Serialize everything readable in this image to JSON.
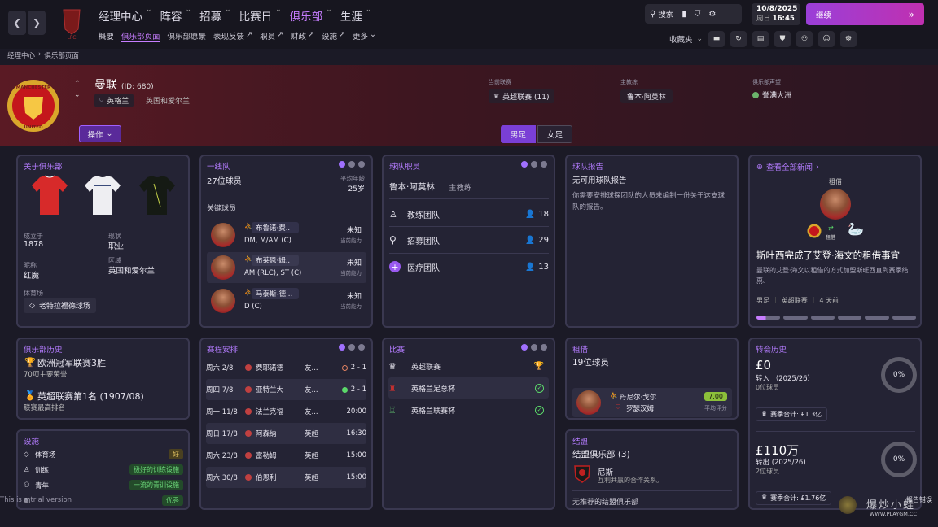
{
  "nav": {
    "main": [
      "经理中心",
      "阵容",
      "招募",
      "比赛日",
      "俱乐部",
      "生涯"
    ],
    "active_main": "俱乐部",
    "sub": [
      "概要",
      "俱乐部页面",
      "俱乐部愿景",
      "表现反馈",
      "职员",
      "财政",
      "设施",
      "更多"
    ],
    "active_sub": "俱乐部页面",
    "search_label": "搜索",
    "date": "10/8/2025",
    "weekday": "周日",
    "time": "16:45",
    "continue_label": "继续",
    "favorites_label": "收藏夹"
  },
  "breadcrumb": [
    "经理中心",
    "俱乐部页面"
  ],
  "club": {
    "name": "曼联",
    "id_text": "(ID: 680)",
    "nation_badge": "英格兰",
    "region": "英国和爱尔兰",
    "league_label": "当前联赛",
    "league": "英超联赛 (11)",
    "coach_label": "主教练",
    "coach": "鲁本·阿莫林",
    "rep_label": "俱乐部声望",
    "rep": "誉满大洲",
    "action_label": "操作",
    "men_label": "男足",
    "women_label": "女足"
  },
  "about": {
    "title": "关于俱乐部",
    "founded_label": "成立于",
    "founded": "1878",
    "status_label": "现状",
    "status": "职业",
    "nick_label": "昵称",
    "nick": "红魔",
    "area_label": "区域",
    "area": "英国和爱尔兰",
    "stadium_label": "体育场",
    "stadium": "老特拉福德球场"
  },
  "first_team": {
    "title": "一线队",
    "count": "27位球员",
    "avg_age_label": "平均年龄",
    "avg_age": "25岁",
    "key_label": "关键球员",
    "players": [
      {
        "name": "布鲁诺·费...",
        "pos": "DM, M/AM (C)",
        "ability": "未知",
        "ability_label": "当前能力"
      },
      {
        "name": "布莱恩·姆...",
        "pos": "AM (RLC), ST (C)",
        "ability": "未知",
        "ability_label": "当前能力"
      },
      {
        "name": "马泰斯-德...",
        "pos": "D (C)",
        "ability": "未知",
        "ability_label": "当前能力"
      }
    ]
  },
  "staff": {
    "title": "球队职员",
    "coach": "鲁本·阿莫林",
    "coach_role": "主教练",
    "groups": [
      {
        "label": "教练团队",
        "count": "18"
      },
      {
        "label": "招募团队",
        "count": "29"
      },
      {
        "label": "医疗团队",
        "count": "13"
      }
    ]
  },
  "report": {
    "title": "球队报告",
    "none": "无可用球队报告",
    "desc": "你需要安排球探团队的人员来编制一份关于这支球队的报告。"
  },
  "news": {
    "link": "查看全部新闻",
    "tag": "租借",
    "sub_tag": "租借",
    "headline": "斯吐西完成了艾登·海文的租借事宜",
    "body": "曼联的艾登·海文以租借的方式加盟斯旺西直到赛季结束。",
    "ellipsis": "...",
    "meta1": "男足",
    "meta2": "英超联赛",
    "meta3": "4 天前"
  },
  "history": {
    "title": "俱乐部历史",
    "h1": "欧洲冠军联赛3胜",
    "h1sub": "70项主要荣誉",
    "h2": "英超联赛第1名 (1907/08)",
    "h2sub": "联赛最高排名"
  },
  "facilities": {
    "title": "设施",
    "items": [
      {
        "label": "体育场",
        "value": "好"
      },
      {
        "label": "训练",
        "value": "极好的训练设施"
      },
      {
        "label": "青年",
        "value": "一流的青训设施"
      },
      {
        "label": "",
        "value": "优秀"
      }
    ]
  },
  "fixtures": {
    "title": "赛程安排",
    "rows": [
      {
        "date": "周六 2/8",
        "team": "费耶诺德",
        "comp": "友...",
        "result": "2 - 1",
        "type": "draw"
      },
      {
        "date": "周四 7/8",
        "team": "亚特兰大",
        "comp": "友...",
        "result": "2 - 1",
        "type": "win"
      },
      {
        "date": "周一 11/8",
        "team": "法兰克福",
        "comp": "友...",
        "result": "20:00",
        "type": ""
      },
      {
        "date": "周日 17/8",
        "team": "阿森纳",
        "comp": "英超",
        "result": "16:30",
        "type": ""
      },
      {
        "date": "周六 23/8",
        "team": "富勒姆",
        "comp": "英超",
        "result": "15:00",
        "type": ""
      },
      {
        "date": "周六 30/8",
        "team": "伯恩利",
        "comp": "英超",
        "result": "15:00",
        "type": ""
      }
    ]
  },
  "competitions": {
    "title": "比赛",
    "items": [
      "英超联赛",
      "英格兰足总杯",
      "英格兰联赛杯"
    ]
  },
  "loans": {
    "title": "租借",
    "count": "19位球员",
    "player": "丹尼尔·戈尔",
    "club": "罗瑟汉姆",
    "rating": "7.00",
    "rating_label": "平均评分"
  },
  "affiliates": {
    "title": "结盟",
    "count": "结盟俱乐部 (3)",
    "club": "尼斯",
    "desc": "互利共赢的合作关系。",
    "none": "无推荐的结盟俱乐部"
  },
  "transfers": {
    "title": "转会历史",
    "in_amount": "£0",
    "in_label": "转入 （2025/26）",
    "in_count": "0位球员",
    "in_pct": "0%",
    "in_total": "赛季合计: £1.3亿",
    "out_amount": "£110万",
    "out_label": "转出 (2025/26)",
    "out_count": "2位球员",
    "out_pct": "0%",
    "out_total": "赛季合计: £1.76亿"
  },
  "footer": {
    "version": "This is a trial version",
    "report": "报告错误",
    "watermark": "爆炒小蛙",
    "watermark_url": "WWW.PLAYGM.CC"
  },
  "colors": {
    "accent": "#b47cff",
    "win": "#5bd86a",
    "card": "#242334"
  }
}
